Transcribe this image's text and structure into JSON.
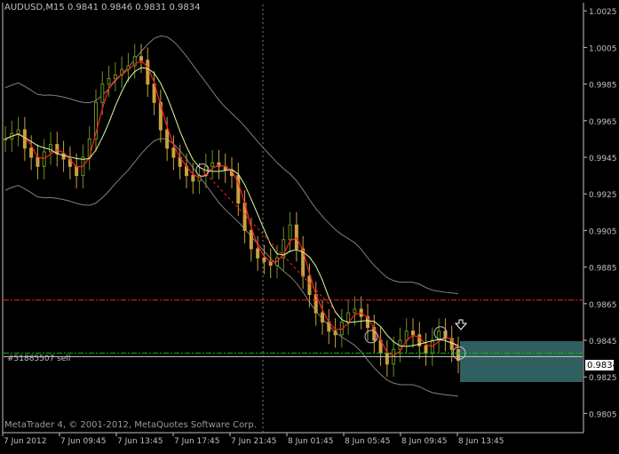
{
  "header": {
    "symbol": "AUDUSD,M15",
    "ohlc": "0.9841 0.9846 0.9831 0.9834"
  },
  "copyright": "MetaTrader 4, © 2001-2012, MetaQuotes Software Corp.",
  "order_label": "#51885507 sell",
  "current_price": "0.9834",
  "colors": {
    "background": "#000000",
    "frame": "#c0c0c0",
    "grid": "#808080",
    "bull_candle": "#6b8e23",
    "bear_candle": "#c8a040",
    "fast_ma": "#ff2020",
    "slow_ma": "#d8ffa0",
    "bands": "#808080",
    "sell_level": "#ff2020",
    "order_line": "#00c000",
    "target_box": "#2f5f5f"
  },
  "chart_data": {
    "type": "candlestick",
    "price_axis_ticks": [
      "1.0025",
      "1.0005",
      "0.9985",
      "0.9965",
      "0.9945",
      "0.9925",
      "0.9905",
      "0.9885",
      "0.9865",
      "0.9845",
      "0.9825",
      "0.9805"
    ],
    "time_axis_ticks": [
      "7 Jun 2012",
      "7 Jun 09:45",
      "7 Jun 13:45",
      "7 Jun 17:45",
      "7 Jun 21:45",
      "8 Jun 01:45",
      "8 Jun 05:45",
      "8 Jun 09:45",
      "8 Jun 13:45"
    ],
    "ylim": [
      0.9795,
      1.0029
    ],
    "horizontal_levels": [
      {
        "price": 0.9867,
        "style": "dash-dot",
        "color": "#ff2020"
      },
      {
        "price": 0.9838,
        "style": "dash-dot",
        "color": "#00c000"
      },
      {
        "price": 0.9836,
        "style": "solid",
        "color": "#c0c0c0"
      }
    ],
    "close_series": [
      0.9955,
      0.9958,
      0.996,
      0.995,
      0.9945,
      0.994,
      0.9948,
      0.9952,
      0.9947,
      0.9944,
      0.994,
      0.9935,
      0.9945,
      0.9955,
      0.9975,
      0.9985,
      0.9988,
      0.999,
      0.9993,
      0.9995,
      1.0,
      0.9998,
      0.9985,
      0.9975,
      0.996,
      0.995,
      0.9945,
      0.994,
      0.9935,
      0.9932,
      0.9935,
      0.994,
      0.9942,
      0.994,
      0.9938,
      0.9935,
      0.992,
      0.9905,
      0.9895,
      0.989,
      0.9888,
      0.9886,
      0.989,
      0.99,
      0.9908,
      0.9895,
      0.988,
      0.987,
      0.986,
      0.9855,
      0.985,
      0.9848,
      0.9855,
      0.986,
      0.9862,
      0.9858,
      0.9852,
      0.9845,
      0.9838,
      0.9832,
      0.984,
      0.9845,
      0.985,
      0.9848,
      0.9842,
      0.9838,
      0.9845,
      0.985,
      0.9846,
      0.984,
      0.9834
    ]
  }
}
